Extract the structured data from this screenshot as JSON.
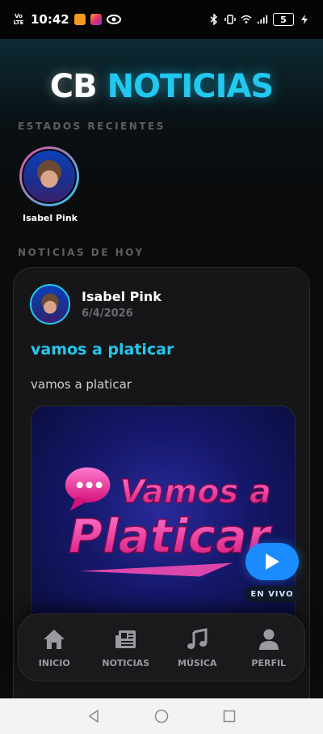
{
  "status_bar": {
    "network": "Vo LTE",
    "time": "10:42",
    "battery": "5"
  },
  "app": {
    "title_part1": "CB",
    "title_part2": "NOTICIAS",
    "accent_color": "#22c8ef"
  },
  "sections": {
    "estados_label": "ESTADOS RECIENTES",
    "hoy_label": "NOTICIAS DE HOY"
  },
  "stories": [
    {
      "name": "Isabel Pink"
    }
  ],
  "post": {
    "author": "Isabel Pink",
    "date": "6/4/2026",
    "title": "vamos a platicar",
    "body": "vamos a platicar",
    "media_text_line1": "Vamos a",
    "media_text_line2": "Platicar"
  },
  "player": {
    "live_label": "EN VIVO",
    "play_icon": "play-icon"
  },
  "nav": {
    "items": [
      {
        "label": "INICIO",
        "icon": "home-icon"
      },
      {
        "label": "NOTICIAS",
        "icon": "newspaper-icon"
      },
      {
        "label": "MÚSICA",
        "icon": "music-icon"
      },
      {
        "label": "PERFIL",
        "icon": "user-icon"
      }
    ]
  }
}
